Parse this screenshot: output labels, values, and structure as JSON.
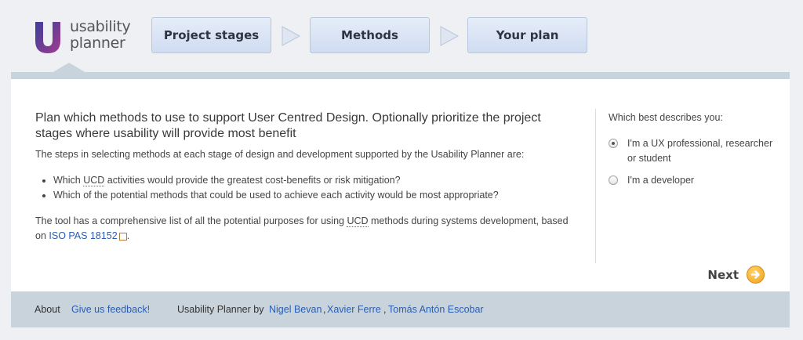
{
  "logo": {
    "line1": "usability",
    "line2": "planner"
  },
  "nav": {
    "stages": [
      "Project stages",
      "Methods",
      "Your plan"
    ]
  },
  "main": {
    "intro": "Plan which methods to use to support User Centred Design. Optionally prioritize the project stages where usability will provide most benefit",
    "steps_text": "The steps in selecting methods at each stage of design and development supported by the Usability Planner are:",
    "bullet1_pre": "Which ",
    "bullet1_abbr": "UCD",
    "bullet1_post": " activities would provide the greatest cost-benefits or risk mitigation?",
    "bullet2": "Which of the potential methods that could be used to achieve each activity would be most appropriate?",
    "tool_pre": "The tool has a comprehensive list of all the potential purposes for using ",
    "tool_abbr": "UCD",
    "tool_post": " methods during systems development, based on ",
    "iso_link": "ISO PAS 18152"
  },
  "sidebar": {
    "question": "Which best describes you:",
    "options": [
      {
        "label": "I'm a UX professional, researcher or student",
        "selected": true
      },
      {
        "label": "I'm a developer",
        "selected": false
      }
    ]
  },
  "next_label": "Next",
  "footer": {
    "about": "About",
    "feedback": "Give us feedback!",
    "credit_prefix": "Usability Planner by",
    "authors": [
      "Nigel Bevan",
      "Xavier Ferre",
      "Tomás Antón Escobar"
    ]
  },
  "colors": {
    "accent_link": "#2a5db0",
    "logo_gradient": [
      "#3b3f9a",
      "#a23b8f"
    ],
    "next_orange": "#f0a11c"
  }
}
